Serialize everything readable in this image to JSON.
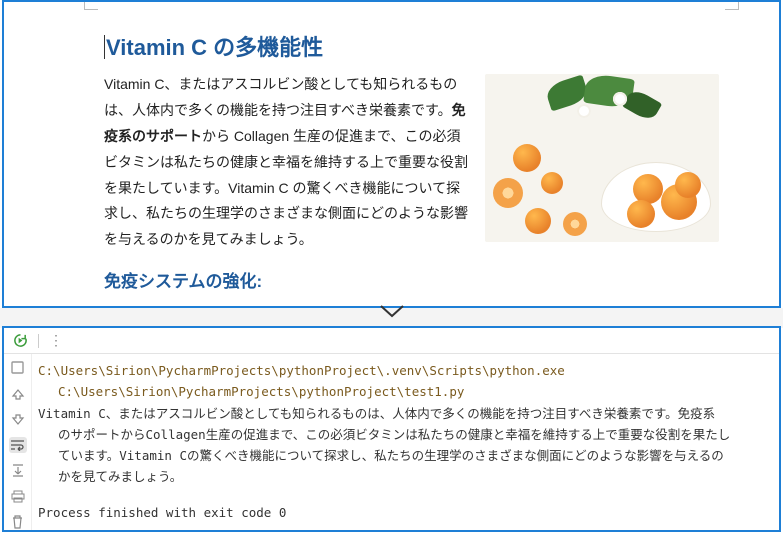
{
  "doc": {
    "h1": "Vitamin C の多機能性",
    "para_pre": "Vitamin C、またはアスコルビン酸としても知られるものは、人体内で多くの機能を持つ注目すべき栄養素です。",
    "para_bold": "免疫系のサポート",
    "para_post": "から Collagen 生産の促進まで、この必須ビタミンは私たちの健康と幸福を維持する上で重要な役割を果たしています。Vitamin C の驚くべき機能について探求し、私たちの生理学のさまざまな側面にどのような影響を与えるのかを見てみましょう。",
    "h2": "免疫システムの強化:"
  },
  "console": {
    "line1": "C:\\Users\\Sirion\\PycharmProjects\\pythonProject\\.venv\\Scripts\\python.exe",
    "line2": "C:\\Users\\Sirion\\PycharmProjects\\pythonProject\\test1.py",
    "out_l1": "Vitamin C、またはアスコルビン酸としても知られるものは、人体内で多くの機能を持つ注目すべき栄養素です。免疫系",
    "out_l2": "のサポートからCollagen生産の促進まで、この必須ビタミンは私たちの健康と幸福を維持する上で重要な役割を果たし",
    "out_l3": "ています。Vitamin Cの驚くべき機能について探求し、私たちの生理学のさまざまな側面にどのような影響を与えるの",
    "out_l4": "かを見てみましょう。",
    "exit": "Process finished with exit code 0"
  },
  "icons": {
    "rerun": "rerun-icon",
    "stop": "stop-icon",
    "up": "up-arrow-icon",
    "down": "down-arrow-icon",
    "wrap": "soft-wrap-icon",
    "scroll": "scroll-to-end-icon",
    "print": "print-icon",
    "trash": "trash-icon"
  }
}
